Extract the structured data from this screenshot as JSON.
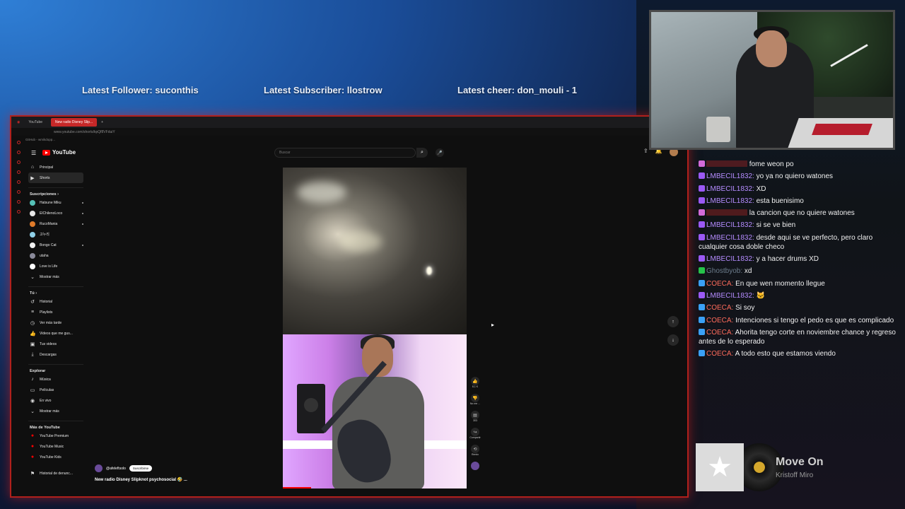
{
  "overlay": {
    "latest_follower": "Latest Follower: suconthis",
    "latest_subscriber": "Latest Subscriber: llostrow",
    "latest_cheer": "Latest cheer: don_mouli - 1"
  },
  "browser": {
    "tabs": [
      "YouTube",
      "New radio Disney Slip..."
    ],
    "url": "www.youtube.com/shorts/kpQf8VFduiY",
    "bookmark": "GitHub - wmikdopp..."
  },
  "youtube": {
    "logo": "YouTube",
    "search_placeholder": "Buscar",
    "sidebar": {
      "main": [
        {
          "label": "Principal",
          "icon": "home-icon"
        },
        {
          "label": "Shorts",
          "icon": "shorts-icon"
        }
      ],
      "subs_header": "Suscripciones",
      "channels": [
        {
          "label": "Hatsune Miku",
          "color": "#55c1b7"
        },
        {
          "label": "ElChilenoLoco",
          "color": "#e6e6e6"
        },
        {
          "label": "RucoMania",
          "color": "#e07b2a"
        },
        {
          "label": "고누리",
          "color": "#8fd0e8"
        },
        {
          "label": "Bongo Cat",
          "color": "#f2f2f2"
        },
        {
          "label": "utaha",
          "color": "#8a8a9a"
        },
        {
          "label": "Love is Life",
          "color": "#ffffff"
        }
      ],
      "show_more_1": "Mostrar más",
      "you_header": "Tú",
      "you": [
        {
          "label": "Historial",
          "icon": "history-icon"
        },
        {
          "label": "Playlists",
          "icon": "playlist-icon"
        },
        {
          "label": "Ver más tarde",
          "icon": "clock-icon"
        },
        {
          "label": "Videos que me gus...",
          "icon": "like-icon"
        },
        {
          "label": "Tus videos",
          "icon": "video-icon"
        },
        {
          "label": "Descargas",
          "icon": "download-icon"
        }
      ],
      "explore_header": "Explorar",
      "explore": [
        {
          "label": "Música",
          "icon": "music-icon"
        },
        {
          "label": "Películas",
          "icon": "film-icon"
        },
        {
          "label": "En vivo",
          "icon": "live-icon"
        }
      ],
      "show_more_2": "Mostrar más",
      "more_header": "Más de YouTube",
      "more": [
        {
          "label": "YouTube Premium"
        },
        {
          "label": "YouTube Music"
        },
        {
          "label": "YouTube Kids"
        }
      ],
      "report": "Historial de denunc..."
    },
    "short": {
      "channel": "@afeleftsolo",
      "subscribe": "Suscribirse",
      "title": "New radio Disney Slipknot psychosocial 🤣 ...",
      "likes": "8,1 K",
      "dislike": "No me ...",
      "comments": "303",
      "share": "Compartir",
      "remix": "Remix"
    }
  },
  "chat": [
    {
      "badge": "b-pink",
      "user": "",
      "user_color": "#c62828",
      "text": "fome weon po",
      "hidden_user": true
    },
    {
      "badge": "b-purple",
      "user": "LMBECIL1832:",
      "user_color": "#b58cff",
      "text": "yo ya no quiero watones"
    },
    {
      "badge": "b-purple",
      "user": "LMBECIL1832:",
      "user_color": "#b58cff",
      "text": "XD"
    },
    {
      "badge": "b-purple",
      "user": "LMBECIL1832:",
      "user_color": "#b58cff",
      "text": "esta buenisimo"
    },
    {
      "badge": "b-pink",
      "user": "",
      "user_color": "#c62828",
      "text": "la cancion que no quiere watones",
      "hidden_user": true
    },
    {
      "badge": "b-purple",
      "user": "LMBECIL1832:",
      "user_color": "#b58cff",
      "text": "si se ve bien"
    },
    {
      "badge": "b-purple",
      "user": "LMBECIL1832:",
      "user_color": "#b58cff",
      "text": "desde aqui se ve perfecto, pero claro cualquier cosa doble checo"
    },
    {
      "badge": "b-purple",
      "user": "LMBECIL1832:",
      "user_color": "#b58cff",
      "text": "y a hacer drums XD"
    },
    {
      "badge": "b-green",
      "user": "Ghostbyob:",
      "user_color": "#6c7c8c",
      "text": "xd"
    },
    {
      "badge": "b-blue",
      "user": "COECA:",
      "user_color": "#ff6b5b",
      "text": "En que wen momento llegue"
    },
    {
      "badge": "b-purple",
      "user": "LMBECIL1832:",
      "user_color": "#b58cff",
      "text": "🐱"
    },
    {
      "badge": "b-blue",
      "user": "COECA:",
      "user_color": "#ff6b5b",
      "text": "Si soy"
    },
    {
      "badge": "b-blue",
      "user": "COECA:",
      "user_color": "#ff6b5b",
      "text": "Intenciones si tengo el pedo es que es complicado"
    },
    {
      "badge": "b-blue",
      "user": "COECA:",
      "user_color": "#ff6b5b",
      "text": "Ahorita tengo corte en noviembre chance y regreso antes de lo esperado"
    },
    {
      "badge": "b-blue",
      "user": "COECA:",
      "user_color": "#ff6b5b",
      "text": "A todo esto que estamos viendo"
    }
  ],
  "now_playing": {
    "title": "Move On",
    "artist": "Kristoff Miro"
  }
}
